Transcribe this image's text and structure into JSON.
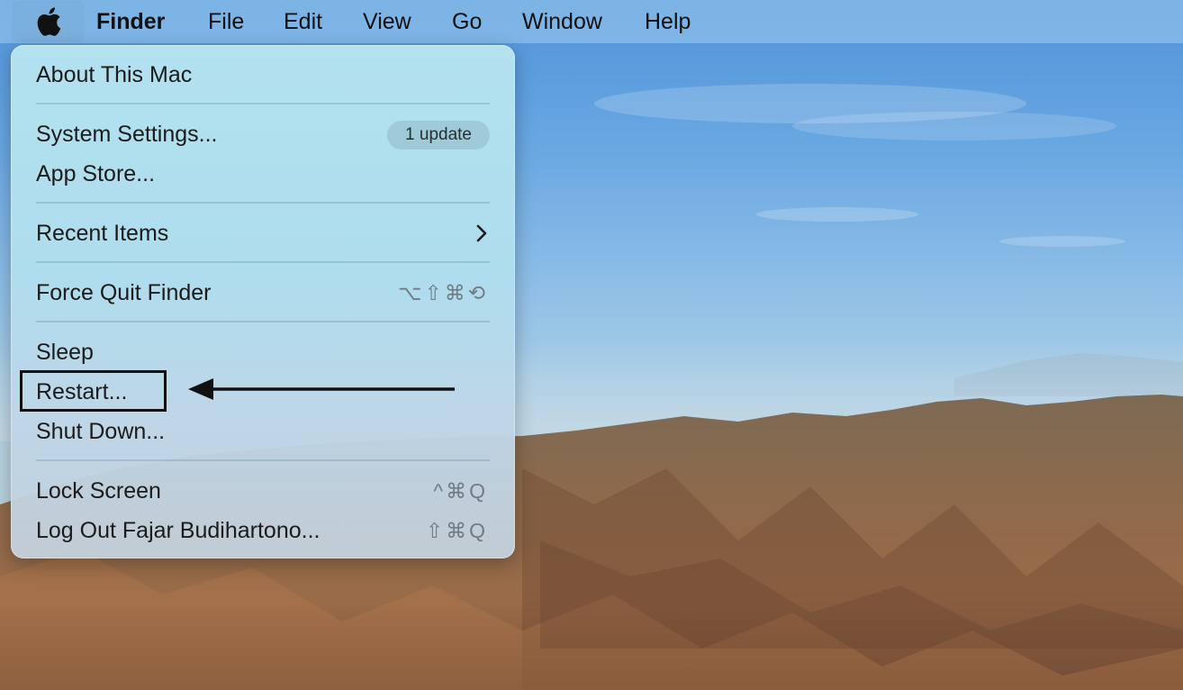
{
  "menubar": {
    "app_name": "Finder",
    "items": [
      "File",
      "Edit",
      "View",
      "Go",
      "Window",
      "Help"
    ]
  },
  "apple_menu": {
    "about": "About This Mac",
    "system_settings": "System Settings...",
    "update_badge": "1 update",
    "app_store": "App Store...",
    "recent_items": "Recent Items",
    "force_quit": "Force Quit Finder",
    "force_quit_shortcut": "⌥⇧⌘⟲",
    "sleep": "Sleep",
    "restart": "Restart...",
    "shut_down": "Shut Down...",
    "lock_screen": "Lock Screen",
    "lock_screen_shortcut": "^⌘Q",
    "log_out": "Log Out Fajar Budihartono...",
    "log_out_shortcut": "⇧⌘Q"
  },
  "colors": {
    "menu_background": "#b0deee",
    "annotation": "#111111"
  },
  "icons": {
    "apple": "apple-logo-icon",
    "submenu": "chevron-right-icon",
    "annotation_arrow": "arrow-left-icon"
  }
}
